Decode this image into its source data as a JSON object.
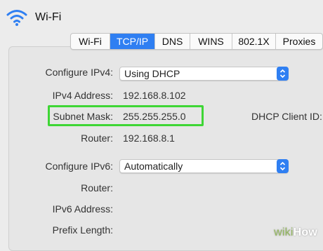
{
  "window": {
    "title": "Wi-Fi"
  },
  "tabs": [
    "Wi-Fi",
    "TCP/IP",
    "DNS",
    "WINS",
    "802.1X",
    "Proxies"
  ],
  "active_tab": "TCP/IP",
  "ipv4": {
    "configure_label": "Configure IPv4:",
    "configure_value": "Using DHCP",
    "address_label": "IPv4 Address:",
    "address_value": "192.168.8.102",
    "subnet_label": "Subnet Mask:",
    "subnet_value": "255.255.255.0",
    "router_label": "Router:",
    "router_value": "192.168.8.1",
    "dhcp_client_id_label": "DHCP Client ID:"
  },
  "ipv6": {
    "configure_label": "Configure IPv6:",
    "configure_value": "Automatically",
    "router_label": "Router:",
    "address_label": "IPv6 Address:",
    "prefix_label": "Prefix Length:"
  },
  "watermark": {
    "brand": "wikiHow",
    "wiki": "wiki",
    "how": "How"
  },
  "colors": {
    "accent": "#2f7ff2",
    "highlight": "#3ed635"
  },
  "icons": {
    "wifi": "wifi-icon",
    "stepper": "up-down-chevron-icon"
  }
}
